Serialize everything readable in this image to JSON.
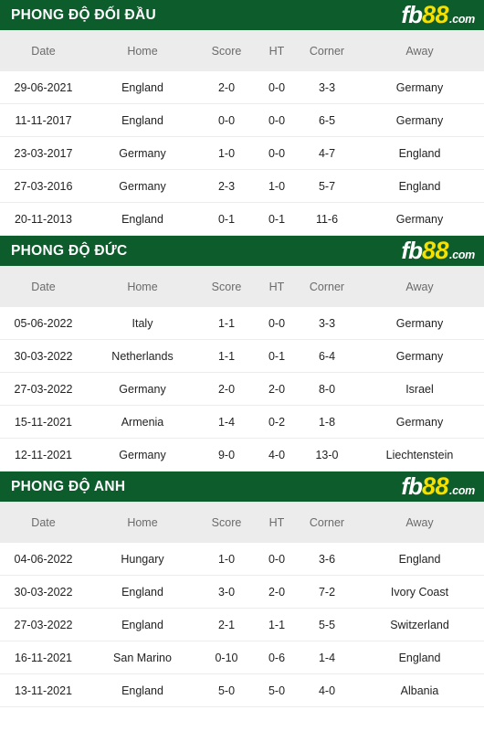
{
  "logo": {
    "part1": "fb",
    "part2": "88",
    "part3": ".com"
  },
  "columns": {
    "date": "Date",
    "home": "Home",
    "score": "Score",
    "ht": "HT",
    "corner": "Corner",
    "away": "Away"
  },
  "colors": {
    "header_green": "#0d5c2c",
    "logo_yellow": "#f5e000",
    "score_red": "#c0392b",
    "team_blue": "#5b9bd5",
    "team_orange": "#e8975e",
    "column_header_bg": "#ececec"
  },
  "sections": [
    {
      "title": "PHONG ĐỘ ĐỐI ĐẦU",
      "rows": [
        {
          "date": "29-06-2021",
          "home": "England",
          "home_style": "blue",
          "score": "2-0",
          "ht": "0-0",
          "corner": "3-3",
          "away": "Germany",
          "away_style": "orange"
        },
        {
          "date": "11-11-2017",
          "home": "England",
          "home_style": "blue",
          "score": "0-0",
          "ht": "0-0",
          "corner": "6-5",
          "away": "Germany",
          "away_style": "orange"
        },
        {
          "date": "23-03-2017",
          "home": "Germany",
          "home_style": "orange",
          "score": "1-0",
          "ht": "0-0",
          "corner": "4-7",
          "away": "England",
          "away_style": "blue"
        },
        {
          "date": "27-03-2016",
          "home": "Germany",
          "home_style": "orange",
          "score": "2-3",
          "ht": "1-0",
          "corner": "5-7",
          "away": "England",
          "away_style": "blue"
        },
        {
          "date": "20-11-2013",
          "home": "England",
          "home_style": "blue",
          "score": "0-1",
          "ht": "0-1",
          "corner": "11-6",
          "away": "Germany",
          "away_style": "orange"
        }
      ]
    },
    {
      "title": "PHONG ĐỘ ĐỨC",
      "rows": [
        {
          "date": "05-06-2022",
          "home": "Italy",
          "home_style": "neutral",
          "score": "1-1",
          "ht": "0-0",
          "corner": "3-3",
          "away": "Germany",
          "away_style": "orange"
        },
        {
          "date": "30-03-2022",
          "home": "Netherlands",
          "home_style": "neutral",
          "score": "1-1",
          "ht": "0-1",
          "corner": "6-4",
          "away": "Germany",
          "away_style": "orange"
        },
        {
          "date": "27-03-2022",
          "home": "Germany",
          "home_style": "orange",
          "score": "2-0",
          "ht": "2-0",
          "corner": "8-0",
          "away": "Israel",
          "away_style": "neutral"
        },
        {
          "date": "15-11-2021",
          "home": "Armenia",
          "home_style": "neutral",
          "score": "1-4",
          "ht": "0-2",
          "corner": "1-8",
          "away": "Germany",
          "away_style": "orange"
        },
        {
          "date": "12-11-2021",
          "home": "Germany",
          "home_style": "orange",
          "score": "9-0",
          "ht": "4-0",
          "corner": "13-0",
          "away": "Liechtenstein",
          "away_style": "neutral"
        }
      ]
    },
    {
      "title": "PHONG ĐỘ ANH",
      "rows": [
        {
          "date": "04-06-2022",
          "home": "Hungary",
          "home_style": "neutral",
          "score": "1-0",
          "ht": "0-0",
          "corner": "3-6",
          "away": "England",
          "away_style": "blue"
        },
        {
          "date": "30-03-2022",
          "home": "England",
          "home_style": "blue",
          "score": "3-0",
          "ht": "2-0",
          "corner": "7-2",
          "away": "Ivory Coast",
          "away_style": "neutral"
        },
        {
          "date": "27-03-2022",
          "home": "England",
          "home_style": "blue",
          "score": "2-1",
          "ht": "1-1",
          "corner": "5-5",
          "away": "Switzerland",
          "away_style": "neutral"
        },
        {
          "date": "16-11-2021",
          "home": "San Marino",
          "home_style": "neutral",
          "score": "0-10",
          "ht": "0-6",
          "corner": "1-4",
          "away": "England",
          "away_style": "blue"
        },
        {
          "date": "13-11-2021",
          "home": "England",
          "home_style": "blue",
          "score": "5-0",
          "ht": "5-0",
          "corner": "4-0",
          "away": "Albania",
          "away_style": "neutral"
        }
      ]
    }
  ]
}
